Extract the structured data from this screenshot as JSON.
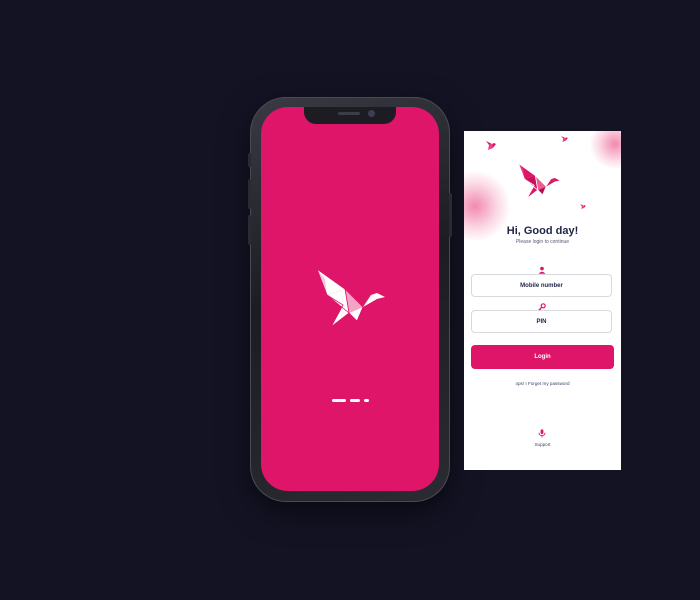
{
  "colors": {
    "background": "#131324",
    "brand_pink": "#de1568",
    "card_background": "#ffffff",
    "heading_text": "#1f2447",
    "field_border": "#d8d9df"
  },
  "splash": {
    "logo_icon": "origami-bird-icon",
    "loader_icon": "loading-dashes-icon"
  },
  "login": {
    "logo_icon": "origami-bird-icon",
    "greeting": "Hi, Good day!",
    "subtitle": "Please login to continue",
    "mobile_field": {
      "icon": "user-icon",
      "placeholder": "Mobile number"
    },
    "pin_field": {
      "icon": "key-icon",
      "placeholder": "PIN"
    },
    "login_button": "Login",
    "forgot_link": "ops! I Forget my password",
    "support": {
      "icon": "microphone-icon",
      "label": "Support"
    }
  }
}
